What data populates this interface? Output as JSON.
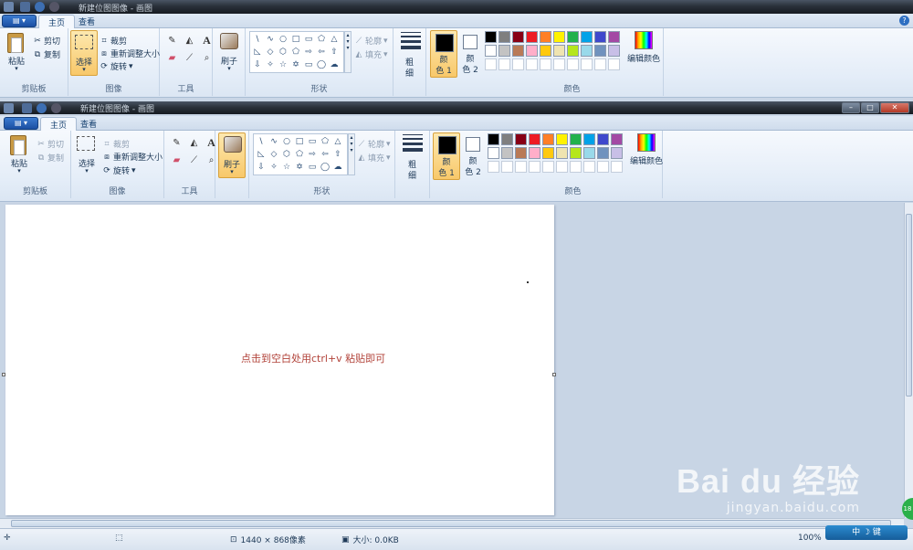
{
  "window": {
    "title": "新建位图图像 - 画图",
    "tabs": [
      "主页",
      "查看"
    ]
  },
  "clipboard": {
    "paste": "粘贴",
    "cut": "剪切",
    "copy": "复制",
    "label": "剪贴板"
  },
  "image": {
    "select": "选择",
    "crop": "裁剪",
    "resize": "重新调整大小",
    "rotate": "旋转",
    "label": "图像"
  },
  "tools": {
    "label": "工具",
    "text_tool": "A"
  },
  "brushes": {
    "label": "刷子"
  },
  "shapes": {
    "outline": "轮廓",
    "fill": "填充",
    "label": "形状",
    "glyphs": [
      "\\",
      "∿",
      "○",
      "□",
      "▭",
      "⬠",
      "△",
      "◺",
      "◇",
      "⬡",
      "⬠",
      "⇨",
      "⇦",
      "⇧",
      "⇩",
      "✧",
      "☆",
      "✡",
      "▭",
      "◯",
      "☁"
    ]
  },
  "size": {
    "label_top": "粗",
    "label_bottom": "细"
  },
  "colors": {
    "color1_top": "颜",
    "color1_bottom": "色 1",
    "color2_top": "颜",
    "color2_bottom": "色 2",
    "edit": "编辑颜色",
    "label": "颜色",
    "color1_value": "#000000",
    "color2_value": "#ffffff",
    "palette": [
      "#000000",
      "#7f7f7f",
      "#880015",
      "#ed1c24",
      "#ff7f27",
      "#fff200",
      "#22b14c",
      "#00a2e8",
      "#3f48cc",
      "#a349a4",
      "#ffffff",
      "#c3c3c3",
      "#b97a57",
      "#ffaec9",
      "#ffc90e",
      "#efe4b0",
      "#b5e61d",
      "#99d9ea",
      "#7092be",
      "#c8bfe7",
      "#ffffff",
      "#ffffff",
      "#ffffff",
      "#ffffff",
      "#ffffff",
      "#ffffff",
      "#ffffff",
      "#ffffff",
      "#ffffff",
      "#ffffff"
    ]
  },
  "canvas": {
    "hint": "点击到空白处用ctrl+v 粘贴即可"
  },
  "status": {
    "dimensions": "1440 × 868像素",
    "filesize": "大小: 0.0KB",
    "zoom": "100%"
  },
  "watermark": {
    "logo": "Bai du 经验",
    "url": "jingyan.baidu.com"
  },
  "ime": {
    "label": "中 ☽ 键"
  }
}
